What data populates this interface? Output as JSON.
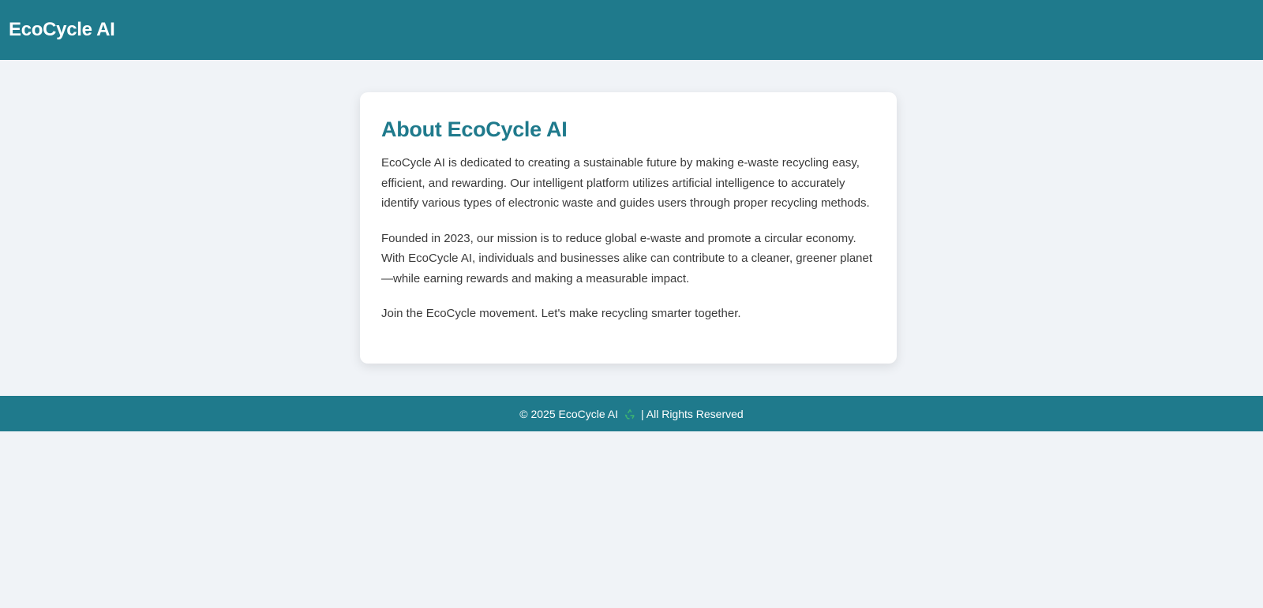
{
  "header": {
    "brand": "EcoCycle AI"
  },
  "about": {
    "title": "About EcoCycle AI",
    "paragraphs": [
      "EcoCycle AI is dedicated to creating a sustainable future by making e-waste recycling easy, efficient, and rewarding. Our intelligent platform utilizes artificial intelligence to accurately identify various types of electronic waste and guides users through proper recycling methods.",
      "Founded in 2023, our mission is to reduce global e-waste and promote a circular economy. With EcoCycle AI, individuals and businesses alike can contribute to a cleaner, greener planet—while earning rewards and making a measurable impact.",
      "Join the EcoCycle movement. Let's make recycling smarter together."
    ]
  },
  "footer": {
    "prefix": "© 2025 EcoCycle AI",
    "icon": "recycle-icon",
    "suffix": "| All Rights Reserved"
  },
  "colors": {
    "primary": "#1f7a8c",
    "background": "#f0f3f7",
    "card": "#ffffff",
    "text": "#3a3a3a",
    "recycle_green": "#3cb371"
  }
}
